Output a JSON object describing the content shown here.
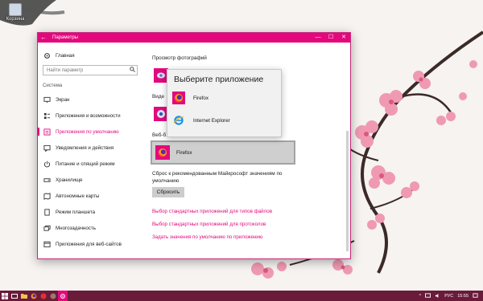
{
  "desktop": {
    "icon_label": "Корзина"
  },
  "window": {
    "title": "Параметры",
    "controls": {
      "minimize": "—",
      "maximize": "☐",
      "close": "✕"
    }
  },
  "sidebar": {
    "home": "Главная",
    "search_placeholder": "Найти параметр",
    "section": "Система",
    "items": [
      {
        "label": "Экран",
        "icon": "display-icon"
      },
      {
        "label": "Приложения и возможности",
        "icon": "apps-list-icon"
      },
      {
        "label": "Приложения по умолчанию",
        "icon": "default-apps-icon",
        "active": true
      },
      {
        "label": "Уведомления и действия",
        "icon": "notification-icon"
      },
      {
        "label": "Питание и спящий режим",
        "icon": "power-icon"
      },
      {
        "label": "Хранилище",
        "icon": "storage-icon"
      },
      {
        "label": "Автономные карты",
        "icon": "map-icon"
      },
      {
        "label": "Режим планшета",
        "icon": "tablet-icon"
      },
      {
        "label": "Многозадачность",
        "icon": "multitasking-icon"
      },
      {
        "label": "Приложения для веб-сайтов",
        "icon": "web-apps-icon"
      }
    ]
  },
  "main": {
    "photo_section": "Просмотр фотографий",
    "video_section_fragment": "Виде",
    "web_section_fragment": "Веб-б",
    "web_browser_app": "Firefox",
    "reset_text": "Сброс к рекомендованным Майкрософт значениям по умолчанию",
    "reset_button": "Сбросить",
    "links": [
      "Выбор стандартных приложений для типов файлов",
      "Выбор стандартных приложений для протоколов",
      "Задать значения по умолчанию по приложению"
    ]
  },
  "flyout": {
    "title": "Выберите приложение",
    "options": [
      {
        "label": "Firefox",
        "icon": "firefox-icon"
      },
      {
        "label": "Internet Explorer",
        "icon": "internet-explorer-icon"
      }
    ]
  },
  "taskbar": {
    "tray_up": "^",
    "language": "РУС",
    "time": "15:55"
  },
  "colors": {
    "accent": "#e3097d",
    "taskbar": "#6a1b3a",
    "selected_app_bg": "#cfcfcf"
  }
}
